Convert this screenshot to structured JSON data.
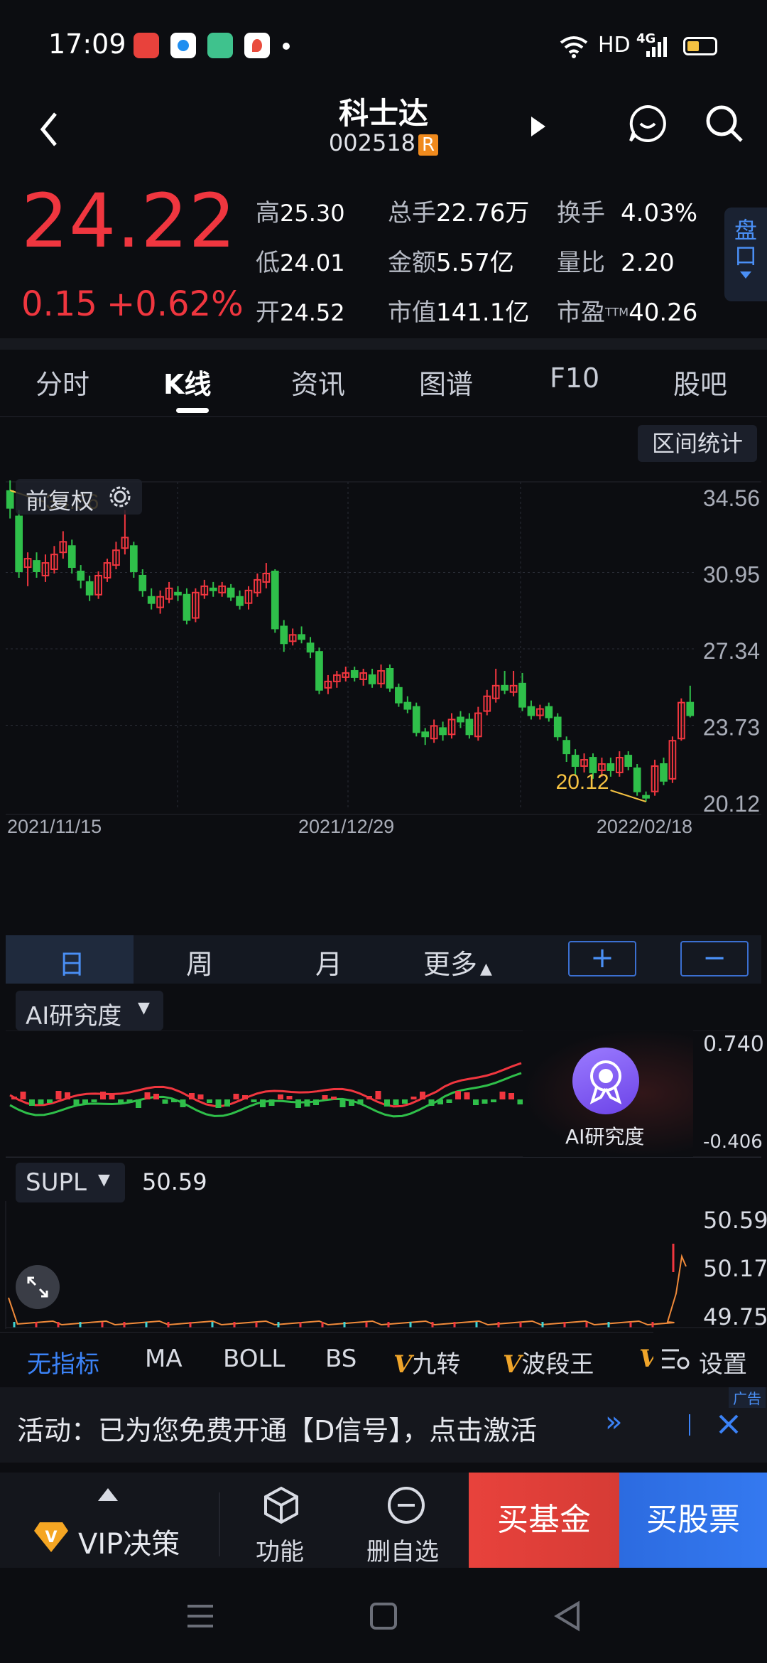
{
  "status": {
    "time": "17:09",
    "network": "HD",
    "signal": "4G"
  },
  "header": {
    "name": "科士达",
    "code": "002518",
    "code_badge": "R"
  },
  "quote": {
    "price": "24.22",
    "change": "0.15",
    "change_pct": "+0.62%",
    "high_label": "高",
    "high": "25.30",
    "low_label": "低",
    "low": "24.01",
    "open_label": "开",
    "open": "24.52",
    "vol_label": "总手",
    "vol": "22.76万",
    "amount_label": "金额",
    "amount": "5.57亿",
    "mcap_label": "市值",
    "mcap": "141.1亿",
    "turnover_label": "换手",
    "turnover": "4.03%",
    "ratio_label": "量比",
    "ratio": "2.20",
    "pe_label": "市盈",
    "pe_sup": "TTM",
    "pe": "40.26",
    "pankou": "盘口"
  },
  "tabs": [
    "分时",
    "K线",
    "资讯",
    "图谱",
    "F10",
    "股吧"
  ],
  "chart_controls": {
    "interval_stats": "区间统计",
    "adjust": "前复权",
    "periods": [
      "日",
      "周",
      "月",
      "更多"
    ],
    "zoom_in": "+",
    "zoom_out": "−"
  },
  "chart_data": {
    "type": "candlestick",
    "y_ticks": [
      "34.56",
      "30.95",
      "27.34",
      "23.73",
      "20.12"
    ],
    "x_ticks": [
      "2021/11/15",
      "2021/12/29",
      "2022/02/18"
    ],
    "ylim": [
      20.12,
      34.56
    ],
    "annotations": {
      "high": "34.56",
      "low": "20.12"
    },
    "candles": [
      [
        34.8,
        34.0,
        35.3,
        33.5
      ],
      [
        33.6,
        31.0,
        33.9,
        30.7
      ],
      [
        31.2,
        31.6,
        31.9,
        30.3
      ],
      [
        31.5,
        31.0,
        31.9,
        30.7
      ],
      [
        30.8,
        31.4,
        31.8,
        30.5
      ],
      [
        31.1,
        31.8,
        32.2,
        30.9
      ],
      [
        31.9,
        32.4,
        32.9,
        31.6
      ],
      [
        32.2,
        31.2,
        32.5,
        30.9
      ],
      [
        31.0,
        30.6,
        31.3,
        30.2
      ],
      [
        30.5,
        29.9,
        30.8,
        29.6
      ],
      [
        29.9,
        30.8,
        31.0,
        29.7
      ],
      [
        30.7,
        31.4,
        31.6,
        30.5
      ],
      [
        31.3,
        32.0,
        32.4,
        31.1
      ],
      [
        32.1,
        32.6,
        33.9,
        31.8
      ],
      [
        32.2,
        31.0,
        32.4,
        30.7
      ],
      [
        30.8,
        30.1,
        31.1,
        29.8
      ],
      [
        29.8,
        29.5,
        30.2,
        29.2
      ],
      [
        29.3,
        29.8,
        30.1,
        29.0
      ],
      [
        29.7,
        30.2,
        30.5,
        29.5
      ],
      [
        30.0,
        29.9,
        30.3,
        29.6
      ],
      [
        29.9,
        28.7,
        30.2,
        28.5
      ],
      [
        28.8,
        30.0,
        30.2,
        28.6
      ],
      [
        29.9,
        30.3,
        30.6,
        29.7
      ],
      [
        30.2,
        30.1,
        30.5,
        29.8
      ],
      [
        30.0,
        30.3,
        30.5,
        29.8
      ],
      [
        30.2,
        29.8,
        30.4,
        29.6
      ],
      [
        29.8,
        29.4,
        30.1,
        29.2
      ],
      [
        29.5,
        30.1,
        30.3,
        29.2
      ],
      [
        30.0,
        30.6,
        30.9,
        29.8
      ],
      [
        30.5,
        30.9,
        31.4,
        30.2
      ],
      [
        31.0,
        28.3,
        31.1,
        28.1
      ],
      [
        28.4,
        27.6,
        28.7,
        27.2
      ],
      [
        27.7,
        28.0,
        28.3,
        27.5
      ],
      [
        28.0,
        27.8,
        28.4,
        27.6
      ],
      [
        27.6,
        27.2,
        27.9,
        26.9
      ],
      [
        27.2,
        25.4,
        27.4,
        25.2
      ],
      [
        25.5,
        25.8,
        26.1,
        25.2
      ],
      [
        25.8,
        26.1,
        26.3,
        25.5
      ],
      [
        26.0,
        26.2,
        26.5,
        25.8
      ],
      [
        26.3,
        26.0,
        26.5,
        25.8
      ],
      [
        25.9,
        26.2,
        26.4,
        25.6
      ],
      [
        26.1,
        25.7,
        26.4,
        25.5
      ],
      [
        25.7,
        26.3,
        26.6,
        25.5
      ],
      [
        26.4,
        25.5,
        26.6,
        25.3
      ],
      [
        25.5,
        24.8,
        25.7,
        24.6
      ],
      [
        24.8,
        24.5,
        25.1,
        24.3
      ],
      [
        24.6,
        23.4,
        24.8,
        23.2
      ],
      [
        23.4,
        23.2,
        23.6,
        22.8
      ],
      [
        23.1,
        23.7,
        24.0,
        22.9
      ],
      [
        23.6,
        23.3,
        23.9,
        23.0
      ],
      [
        23.3,
        24.0,
        24.3,
        23.1
      ],
      [
        24.1,
        23.9,
        24.4,
        23.6
      ],
      [
        24.0,
        23.3,
        24.3,
        23.1
      ],
      [
        23.2,
        24.3,
        24.6,
        23.0
      ],
      [
        24.4,
        25.1,
        25.4,
        24.2
      ],
      [
        25.0,
        25.6,
        26.4,
        24.8
      ],
      [
        25.6,
        25.4,
        26.3,
        25.2
      ],
      [
        25.3,
        25.6,
        26.3,
        25.1
      ],
      [
        25.7,
        24.6,
        26.2,
        24.4
      ],
      [
        24.6,
        24.2,
        24.9,
        24.0
      ],
      [
        24.2,
        24.5,
        24.7,
        24.0
      ],
      [
        24.6,
        24.1,
        24.8,
        23.9
      ],
      [
        24.1,
        23.2,
        24.3,
        23.0
      ],
      [
        23.0,
        22.4,
        23.2,
        22.0
      ],
      [
        22.3,
        21.8,
        22.6,
        21.4
      ],
      [
        21.8,
        22.1,
        22.4,
        21.5
      ],
      [
        22.2,
        21.5,
        22.4,
        21.2
      ],
      [
        21.6,
        21.9,
        22.2,
        21.3
      ],
      [
        21.9,
        21.6,
        22.2,
        21.3
      ],
      [
        21.5,
        22.2,
        22.5,
        21.3
      ],
      [
        22.3,
        21.8,
        22.5,
        21.6
      ],
      [
        21.7,
        20.6,
        21.9,
        20.4
      ],
      [
        20.4,
        20.3,
        20.6,
        20.12
      ],
      [
        20.6,
        21.8,
        22.1,
        20.4
      ],
      [
        21.9,
        21.1,
        22.2,
        20.9
      ],
      [
        21.2,
        23.0,
        23.2,
        21.0
      ],
      [
        23.1,
        24.8,
        25.0,
        23.0
      ],
      [
        24.8,
        24.2,
        25.6,
        24.1
      ]
    ]
  },
  "ai_panel": {
    "label": "AI研究度",
    "ymax": "0.740",
    "ymin": "-0.406",
    "badge_label": "AI研究度"
  },
  "supl_panel": {
    "label": "SUPL",
    "value": "50.59",
    "y_ticks": [
      "50.59",
      "50.17",
      "49.75"
    ]
  },
  "indicators": [
    "无指标",
    "MA",
    "BOLL",
    "BS",
    "九转",
    "波段王"
  ],
  "indicator_settings": "设置",
  "ad_tag": "广告",
  "promo": {
    "text": "活动：已为您免费开通【D信号】，点击激活"
  },
  "bottom": {
    "vip": "VIP决策",
    "func": "功能",
    "remove": "删自选",
    "buy_fund": "买基金",
    "buy_stock": "买股票"
  },
  "colors": {
    "up": "#f0363f",
    "down": "#2fbf4a",
    "accent": "#3b82f6",
    "gold": "#f5c242"
  }
}
